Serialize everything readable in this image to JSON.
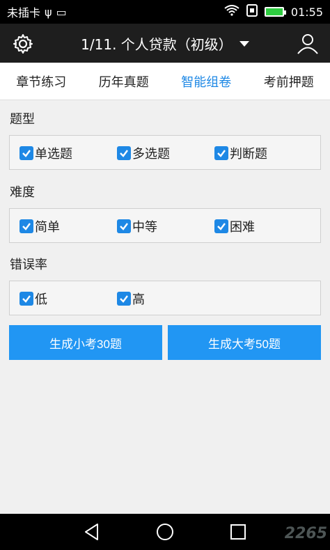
{
  "status_bar": {
    "carrier": "未插卡",
    "time": "01:55"
  },
  "app_bar": {
    "title": "1/11. 个人贷款（初级）"
  },
  "tabs": [
    {
      "label": "章节练习"
    },
    {
      "label": "历年真题"
    },
    {
      "label": "智能组卷",
      "active": true
    },
    {
      "label": "考前押题"
    }
  ],
  "sections": {
    "type": {
      "title": "题型",
      "options": [
        "单选题",
        "多选题",
        "判断题"
      ]
    },
    "difficulty": {
      "title": "难度",
      "options": [
        "简单",
        "中等",
        "困难"
      ]
    },
    "error_rate": {
      "title": "错误率",
      "options": [
        "低",
        "高"
      ]
    }
  },
  "buttons": {
    "small_exam": "生成小考30题",
    "big_exam": "生成大考50题"
  },
  "watermark": "2265",
  "colors": {
    "accent": "#2196f3",
    "active_tab": "#1e88e5",
    "app_bar": "#1e1e1e"
  }
}
